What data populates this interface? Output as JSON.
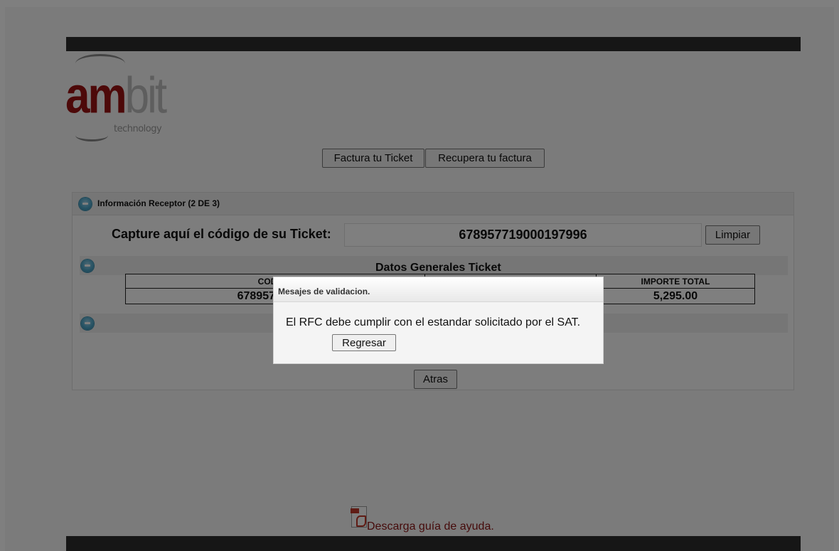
{
  "header": {
    "logo": {
      "primary": "am",
      "secondary": "bit",
      "tagline": "technology"
    }
  },
  "nav": {
    "factura_label": "Factura tu Ticket",
    "recupera_label": "Recupera tu factura"
  },
  "panel": {
    "title": "Información Receptor (2 DE 3)",
    "capture_label": "Capture aquí el código de su Ticket:",
    "ticket_code": "678957719000197996",
    "limpiar_label": "Limpiar",
    "datos_title": "Datos Generales Ticket",
    "table": {
      "headers": [
        "CODIGO",
        "IMPORTE TOTAL"
      ],
      "rows": [
        [
          "678957719000",
          "5,295.00"
        ]
      ]
    },
    "atras_label": "Atras"
  },
  "footer": {
    "help_link": "Descarga guía de ayuda."
  },
  "modal": {
    "title": "Mesajes de validacion.",
    "message": "El RFC debe cumplir con el estandar solicitado por el SAT.",
    "regresar_label": "Regresar"
  },
  "colors": {
    "brand_red": "#9b1212",
    "bar_dark": "#2d2d2d",
    "link_red": "#8b1414",
    "icon_blue": "#4ea6c9"
  },
  "icons": [
    "collapse-circle-icon",
    "pdf-icon"
  ]
}
